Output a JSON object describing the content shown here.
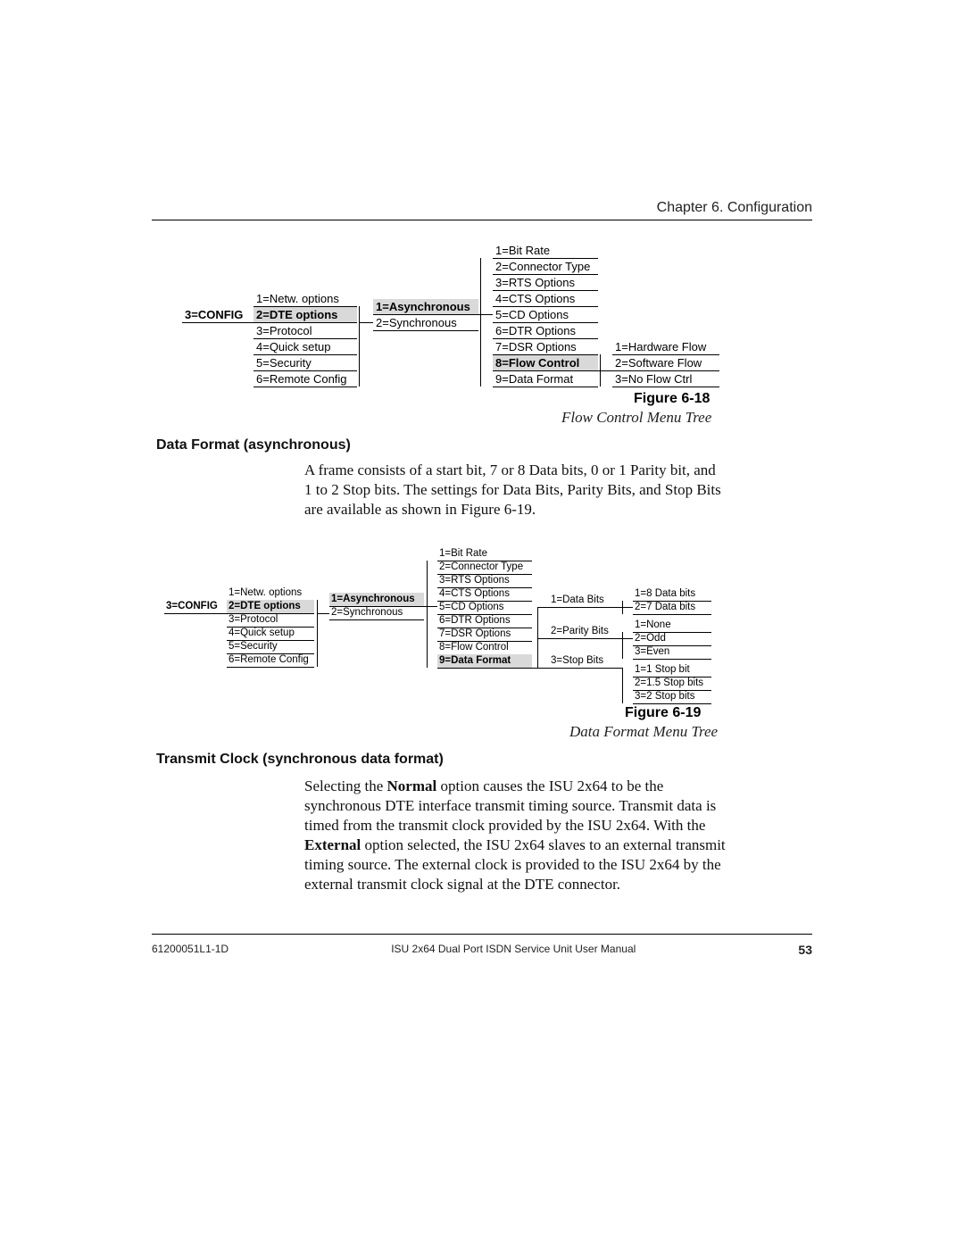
{
  "header": {
    "chapter": "Chapter 6.  Configuration"
  },
  "footer": {
    "docid": "61200051L1-1D",
    "title": "ISU 2x64 Dual Port ISDN Service Unit User Manual",
    "pageno": "53"
  },
  "tree18": {
    "root": "3=CONFIG",
    "col1": [
      "1=Netw. options",
      "2=DTE options",
      "3=Protocol",
      "4=Quick setup",
      "5=Security",
      "6=Remote Config"
    ],
    "col2": [
      "1=Asynchronous",
      "2=Synchronous"
    ],
    "col3": [
      "1=Bit Rate",
      "2=Connector Type",
      "3=RTS Options",
      "4=CTS Options",
      "5=CD Options",
      "6=DTR Options",
      "7=DSR Options",
      "8=Flow Control",
      "9=Data Format"
    ],
    "col4": [
      "1=Hardware Flow",
      "2=Software Flow",
      "3=No Flow Ctrl"
    ],
    "figure_label": "Figure 6-18",
    "figure_caption": "Flow Control Menu Tree"
  },
  "section1": {
    "heading": "Data Format (asynchronous)",
    "body": "A frame consists of a start bit, 7 or 8 Data bits, 0 or 1 Parity bit, and 1 to 2 Stop bits.  The settings for Data Bits, Parity Bits, and Stop Bits are available as shown in Figure 6-19."
  },
  "tree19": {
    "root": "3=CONFIG",
    "col1": [
      "1=Netw. options",
      "2=DTE options",
      "3=Protocol",
      "4=Quick setup",
      "5=Security",
      "6=Remote Config"
    ],
    "col2": [
      "1=Asynchronous",
      "2=Synchronous"
    ],
    "col3": [
      "1=Bit Rate",
      "2=Connector Type",
      "3=RTS Options",
      "4=CTS Options",
      "5=CD Options",
      "6=DTR Options",
      "7=DSR Options",
      "8=Flow Control",
      "9=Data Format"
    ],
    "col4": [
      "1=Data Bits",
      "2=Parity Bits",
      "3=Stop Bits"
    ],
    "col5a": [
      "1=8 Data bits",
      "2=7 Data bits"
    ],
    "col5b": [
      "1=None",
      "2=Odd",
      "3=Even"
    ],
    "col5c": [
      "1=1 Stop bit",
      "2=1.5 Stop bits",
      "3=2 Stop bits"
    ],
    "figure_label": "Figure 6-19",
    "figure_caption": "Data Format Menu Tree"
  },
  "section2": {
    "heading": "Transmit Clock (synchronous data format)",
    "body_pre": "Selecting the ",
    "body_b1": "Normal",
    "body_mid1": " option causes the ISU 2x64 to be the synchronous DTE interface transmit timing source.  Transmit data is timed from the transmit clock provided by the ISU 2x64.  With the ",
    "body_b2": "External",
    "body_mid2": " option selected, the ISU 2x64 slaves to an external transmit timing source.  The external clock is provided to the ISU 2x64 by the external transmit clock signal at the DTE connector."
  }
}
